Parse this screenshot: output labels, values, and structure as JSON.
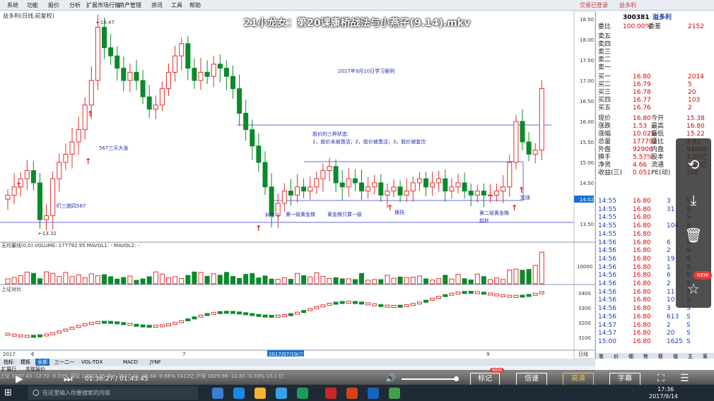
{
  "menu": [
    "系统",
    "功能",
    "报价",
    "分析",
    "扩展市场行情",
    "资产管理",
    "资讯",
    "工具",
    "帮助"
  ],
  "menu_right": [
    "交易已登录",
    "益多利"
  ],
  "video_title": "21小龙女：第20课康桥战法与小燕子(9.14).mkv",
  "chart": {
    "header": "益多利(日线,前复权)",
    "price_axis": [
      "18.50",
      "18.00",
      "17.50",
      "17.00",
      "16.50",
      "16.00",
      "15.50",
      "15.00",
      "14.50",
      "14.02",
      "13.50"
    ],
    "high_label": "18.47",
    "low_label": "13.32",
    "annotations": {
      "study": "2017年9月10日学习案例",
      "ma567": "567三天大涨",
      "ding": "盯三脱四567",
      "state_title": "股价的三种状态：",
      "state_body": "1，股价未被激活；2，股价被激活；3，股价被套住",
      "lichen": "利车  1",
      "gold1": "第一级黄金梯",
      "gold_only": "黄金梯只算一级",
      "huan": "换挡",
      "gold2a": "第二级黄金梯",
      "gold2b": "起柱",
      "jiamai": "加涨"
    },
    "vol_header": "无均量线(0,0)  VOLUME: 177792.95  MAVOL1: -  MAVOL2: -",
    "vol_axis": "10000",
    "idx_header": "上证对比",
    "idx_axis": [
      "3400",
      "3300",
      "3200",
      "3100"
    ],
    "date_labels": [
      "2017",
      "6",
      "7",
      "2017/07/19/三",
      "9",
      "日线"
    ]
  },
  "quote": {
    "code": "300381",
    "name": "溢多利",
    "weibi": {
      "label": "委比",
      "value": "100.00%",
      "label2": "委差",
      "value2": "2152"
    },
    "sell": [
      {
        "l": "卖五"
      },
      {
        "l": "卖四"
      },
      {
        "l": "卖三"
      },
      {
        "l": "卖二"
      },
      {
        "l": "卖一"
      }
    ],
    "buy": [
      {
        "l": "买一",
        "p": "16.80",
        "v": "2014"
      },
      {
        "l": "买二",
        "p": "16.79",
        "v": "5"
      },
      {
        "l": "买三",
        "p": "16.78",
        "v": "20"
      },
      {
        "l": "买四",
        "p": "16.77",
        "v": "103"
      },
      {
        "l": "买五",
        "p": "16.76",
        "v": "2"
      }
    ],
    "stats": [
      {
        "a": "现价",
        "b": "16.80",
        "c": "今开",
        "d": "15.38"
      },
      {
        "a": "涨跌",
        "b": "1.53",
        "c": "最高",
        "d": "16.80"
      },
      {
        "a": "涨幅",
        "b": "10.02%",
        "c": "最低",
        "d": "15.22"
      },
      {
        "a": "总量",
        "b": "177792",
        "c": "量比",
        "d": "2.91"
      },
      {
        "a": "外盘",
        "b": "92906",
        "c": "内盘",
        "d": "84886"
      },
      {
        "a": "换手",
        "b": "5.57%",
        "c": "股本",
        "d": "4.05亿"
      },
      {
        "a": "净资",
        "b": "4.66",
        "c": "流通",
        "d": "3.19亿"
      },
      {
        "a": "收益(三)",
        "b": "0.051",
        "c": "PE(动)",
        "d": "246"
      }
    ],
    "ticks": [
      {
        "t": "14:55",
        "p": "16.80",
        "v": "3"
      },
      {
        "t": "14:55",
        "p": "16.80",
        "v": "31"
      },
      {
        "t": "14:55",
        "p": "16.80",
        "v": ""
      },
      {
        "t": "14:55",
        "p": "16.80",
        "v": "104"
      },
      {
        "t": "14:55",
        "p": "16.80",
        "v": ""
      },
      {
        "t": "14:56",
        "p": "16.80",
        "v": "6"
      },
      {
        "t": "14:56",
        "p": "16.80",
        "v": "2"
      },
      {
        "t": "14:56",
        "p": "16.80",
        "v": "19"
      },
      {
        "t": "14:56",
        "p": "16.80",
        "v": "1"
      },
      {
        "t": "14:56",
        "p": "16.80",
        "v": "6"
      },
      {
        "t": "14:56",
        "p": "16.80",
        "v": "2"
      },
      {
        "t": "14:56",
        "p": "16.80",
        "v": "11"
      },
      {
        "t": "14:56",
        "p": "16.80",
        "v": "10"
      },
      {
        "t": "14:56",
        "p": "16.80",
        "v": "3"
      },
      {
        "t": "14:56",
        "p": "16.80",
        "v": "613"
      },
      {
        "t": "14:57",
        "p": "16.80",
        "v": "2"
      },
      {
        "t": "14:57",
        "p": "16.80",
        "v": "20"
      },
      {
        "t": "15:00",
        "p": "16.80",
        "v": "1625"
      }
    ],
    "bottom_tabs": [
      "笔",
      "价",
      "细",
      "势",
      "联",
      "值",
      "主",
      "筹"
    ]
  },
  "tabs": [
    "指标",
    "模板",
    "全部",
    "三一二一",
    "VOL-TDX",
    "MACD",
    "JYNF"
  ],
  "subtabs": [
    "扩展行",
    "关联报价"
  ],
  "status": "上证 3387.43 -12.72 -0.33%  深证 10927.75  中小 7517.13 -49.64 -0.66%  1412亿  沪深 3829.96 -12.65 -0.33%  10.1 亿",
  "player": {
    "time": "01:36:27 / 01:43:45",
    "btn_note": "标记",
    "btn_speed": "倍速",
    "btn_hd": "高清",
    "btn_sub": "字幕",
    "new": "NEW"
  },
  "taskbar": {
    "search": "在这里输入你要搜索的内容",
    "clock": "17:36",
    "date": "2017/9/14"
  },
  "share_new": "NEW"
}
